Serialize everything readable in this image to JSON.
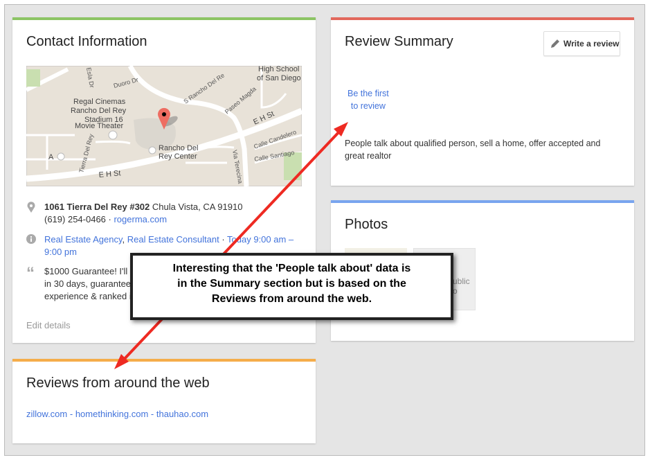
{
  "contact": {
    "title": "Contact Information",
    "map_labels": {
      "school": [
        "High School",
        "of San Diego"
      ],
      "s_rancho": "S Rancho Del Re",
      "duoro": "Duoro Dr",
      "esla": "Esla Dr",
      "cinema": [
        "Regal Cinemas",
        "Rancho Del Rey",
        "Stadium 16",
        "Movie Theater"
      ],
      "paseo": "Paseo Magda",
      "eh1": "E H St",
      "eh2": "E H St",
      "tierra": "Tierra Del Rey",
      "center": [
        "Rancho Del",
        "Rey Center"
      ],
      "candelero": "Calle Candelero",
      "santiago": "Calle Santiago",
      "terecina": "Via Terecina",
      "a": "A"
    },
    "address_bold": "1061 Tierra Del Rey #302",
    "address_rest": " Chula Vista, CA 91910",
    "phone": "(619) 254-0466",
    "sep": " · ",
    "website": "rogerma.com",
    "category1": "Real Estate Agency",
    "comma": ", ",
    "category2": "Real Estate Consultant",
    "hours": "Today 9:00 am – 9:00 pm",
    "desc_lines": [
      "$1000 Guarantee! I'll f",
      "in 30 days, guarantee",
      "experience & ranked i"
    ],
    "edit": "Edit details"
  },
  "web_reviews": {
    "title": "Reviews from around the web",
    "sources": [
      "zillow.com",
      "homethinking.com",
      "thauhao.com"
    ],
    "sep": " - "
  },
  "summary": {
    "title": "Review Summary",
    "write_button": "Write a review",
    "first_line1": "Be the first",
    "first_line2": "to review",
    "people_talk": "People talk about qualified person, sell a home, offer accepted and great realtor"
  },
  "photos": {
    "title": "Photos",
    "placeholder_fragment1": "ublic",
    "placeholder_fragment2": "o"
  },
  "callout": {
    "lines": [
      "Interesting that the 'People talk about' data is",
      "in the Summary section but is based on the",
      "Reviews from around the web."
    ]
  },
  "colors": {
    "contact": "#8cc464",
    "web": "#f5ad4a",
    "summary": "#e2685c",
    "photos": "#79a5ef",
    "link": "#4273db",
    "arrow": "#ee2a22"
  }
}
